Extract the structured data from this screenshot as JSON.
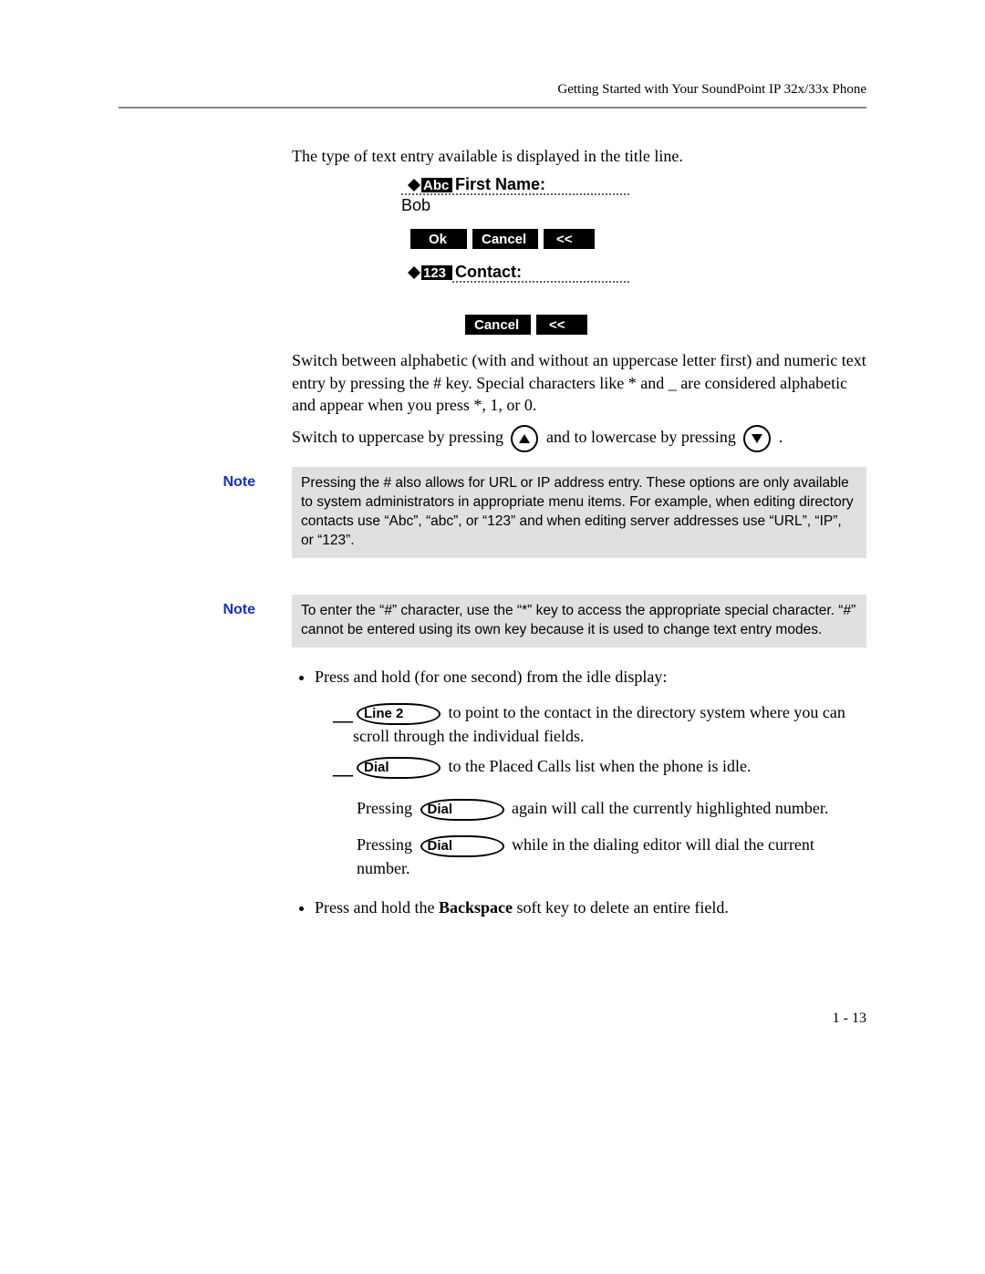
{
  "header": {
    "title": "Getting Started with Your SoundPoint IP 32x/33x Phone"
  },
  "body": {
    "p1": "The type of text entry available is displayed in the title line.",
    "lcd1": {
      "mode": "Abc",
      "field_label": "First Name:",
      "value": "Bob",
      "btn_ok": "Ok",
      "btn_cancel": "Cancel",
      "btn_back": "<<"
    },
    "lcd2": {
      "mode": "123",
      "field_label": "Contact:",
      "btn_cancel": "Cancel",
      "btn_back": "<<"
    },
    "p2": "Switch between alphabetic (with and without an uppercase letter first) and numeric text entry by pressing the # key. Special characters like * and _ are considered alphabetic and appear when you press *, 1, or 0.",
    "p3_a": "Switch to uppercase by pressing ",
    "p3_b": " and to lowercase by pressing ",
    "p3_c": " ."
  },
  "notes": {
    "label": "Note",
    "n1": "Pressing the # also allows for URL or IP address entry. These options are only available to system administrators in appropriate menu items. For example, when editing directory contacts use “Abc”, “abc”, or “123” and when editing server addresses use “URL”, “IP”, or “123”.",
    "n2": "To enter the “#” character, use the “*” key to access the appropriate special character. “#” cannot be entered using its own key because it is used to change text entry modes."
  },
  "list": {
    "b1": "Press and hold (for one second) from the idle display:",
    "s1_key": "Line 2",
    "s1_txt": " to point to the contact in the directory system where you can scroll through the individual fields.",
    "s2_key": "Dial",
    "s2_txt": " to the Placed Calls list when the phone is idle.",
    "p1_a": "Pressing ",
    "p1_key": "Dial",
    "p1_b": " again will call the currently highlighted number.",
    "p2_a": "Pressing ",
    "p2_key": "Dial",
    "p2_b": " while in the dialing editor will dial the current number.",
    "b2_a": "Press and hold the ",
    "b2_bold": "Backspace",
    "b2_b": " soft key to delete an entire field."
  },
  "footer": {
    "page": "1 - 13"
  }
}
